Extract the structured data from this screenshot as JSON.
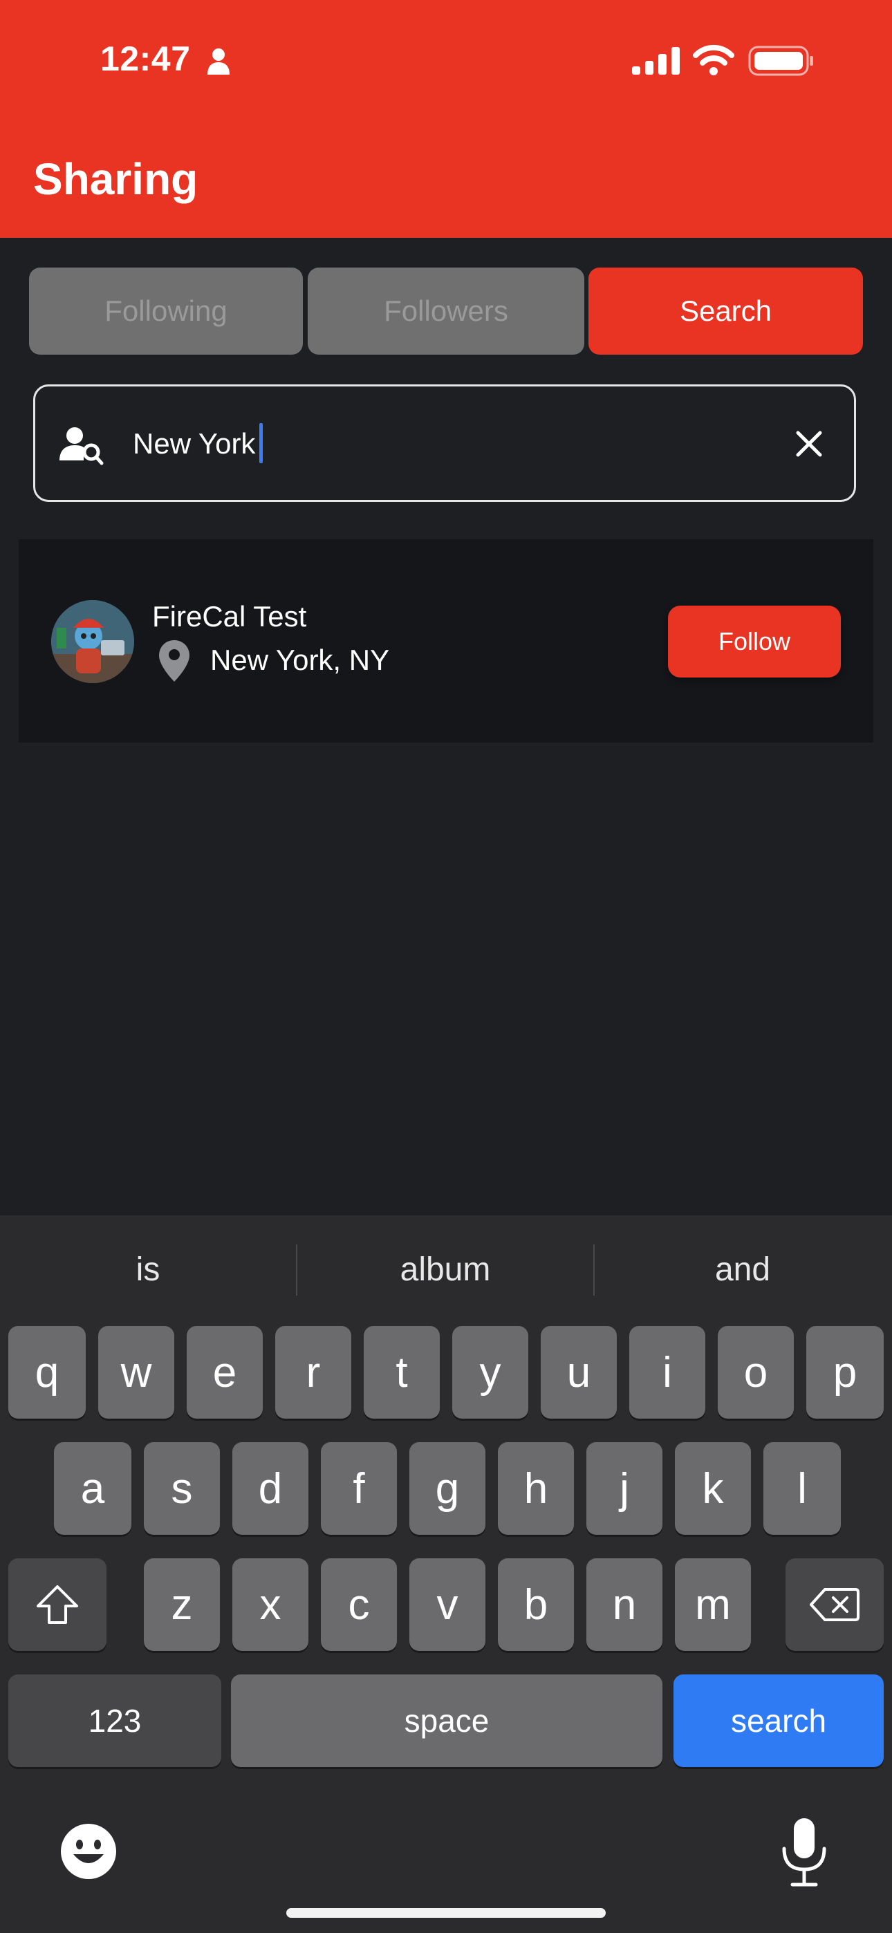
{
  "status_bar": {
    "time": "12:47",
    "icons": [
      "person-icon",
      "signal-icon",
      "wifi-icon",
      "battery-icon"
    ]
  },
  "header": {
    "title": "Sharing"
  },
  "tabs": [
    {
      "label": "Following",
      "selected": false
    },
    {
      "label": "Followers",
      "selected": false
    },
    {
      "label": "Search",
      "selected": true
    }
  ],
  "search": {
    "value": "New York"
  },
  "results": [
    {
      "name": "FireCal Test",
      "location": "New York, NY",
      "action_label": "Follow"
    }
  ],
  "keyboard": {
    "suggestions": [
      "is",
      "album",
      "and"
    ],
    "row1": [
      "q",
      "w",
      "e",
      "r",
      "t",
      "y",
      "u",
      "i",
      "o",
      "p"
    ],
    "row2": [
      "a",
      "s",
      "d",
      "f",
      "g",
      "h",
      "j",
      "k",
      "l"
    ],
    "row3": [
      "z",
      "x",
      "c",
      "v",
      "b",
      "n",
      "m"
    ],
    "numbers_label": "123",
    "space_label": "space",
    "action_label": "search"
  },
  "colors": {
    "accent": "#e93424",
    "background": "#1d1f23",
    "card": "#15161a",
    "tab_inactive": "#707070",
    "keyboard_action": "#2f7bf4"
  }
}
